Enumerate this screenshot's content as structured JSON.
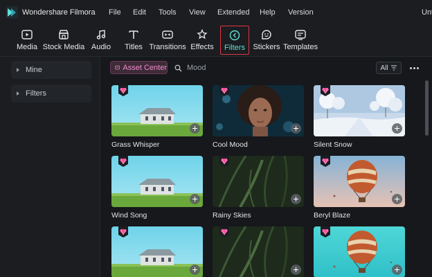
{
  "app": {
    "name": "Wondershare Filmora",
    "doc_title": "Unt"
  },
  "menu": [
    "File",
    "Edit",
    "Tools",
    "View",
    "Extended",
    "Help",
    "Version"
  ],
  "toolbar": {
    "items": [
      {
        "label": "Media",
        "icon": "media-icon"
      },
      {
        "label": "Stock Media",
        "icon": "stock-media-icon"
      },
      {
        "label": "Audio",
        "icon": "audio-icon"
      },
      {
        "label": "Titles",
        "icon": "titles-icon"
      },
      {
        "label": "Transitions",
        "icon": "transitions-icon"
      },
      {
        "label": "Effects",
        "icon": "effects-icon"
      },
      {
        "label": "Filters",
        "icon": "filters-icon",
        "active": true
      },
      {
        "label": "Stickers",
        "icon": "stickers-icon"
      },
      {
        "label": "Templates",
        "icon": "templates-icon"
      }
    ]
  },
  "sidebar": {
    "items": [
      {
        "label": "Mine"
      },
      {
        "label": "Filters"
      }
    ]
  },
  "content": {
    "asset_center_label": "Asset Center",
    "search_placeholder": "Mood",
    "filter_all_label": "All"
  },
  "cards": [
    {
      "label": "Grass Whisper",
      "scene": "house",
      "premium": true
    },
    {
      "label": "Cool Mood",
      "scene": "portrait",
      "premium": true
    },
    {
      "label": "Silent Snow",
      "scene": "snow",
      "premium": true
    },
    {
      "label": "Wind Song",
      "scene": "house",
      "premium": true
    },
    {
      "label": "Rainy Skies",
      "scene": "grass",
      "premium": true
    },
    {
      "label": "Beryl Blaze",
      "scene": "balloon",
      "premium": true
    },
    {
      "label": "",
      "scene": "house",
      "premium": true
    },
    {
      "label": "",
      "scene": "grass",
      "premium": true
    },
    {
      "label": "",
      "scene": "balloon-teal",
      "premium": true
    }
  ],
  "colors": {
    "accent": "#5fe0d2",
    "highlight_border": "#e0373f",
    "premium": "#f0509a",
    "asset_center": "#f08ccd"
  }
}
